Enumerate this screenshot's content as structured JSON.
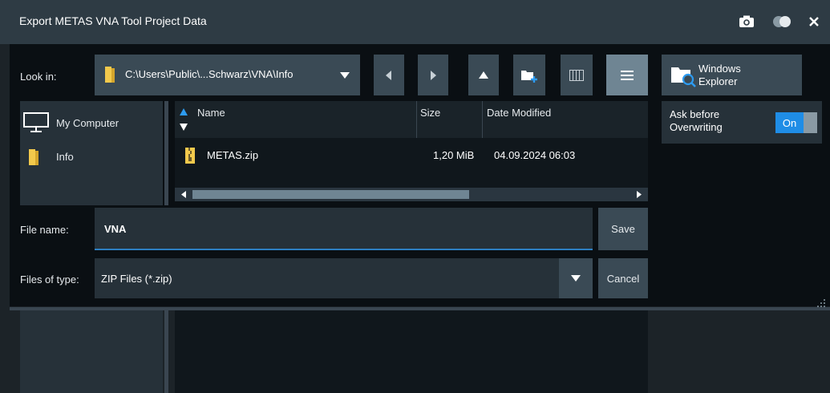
{
  "title": "Export METAS VNA Tool Project Data",
  "look_in": {
    "label": "Look in:",
    "path": "C:\\Users\\Public\\...Schwarz\\VNA\\Info"
  },
  "windows_explorer": {
    "line1": "Windows",
    "line2": "Explorer"
  },
  "ask_overwrite": {
    "line1": "Ask before",
    "line2": "Overwriting",
    "state": "On"
  },
  "places": [
    {
      "label": "My Computer",
      "icon": "computer-icon"
    },
    {
      "label": "Info",
      "icon": "folder-icon"
    }
  ],
  "columns": {
    "name": "Name",
    "size": "Size",
    "date": "Date Modified"
  },
  "files": [
    {
      "name": "METAS.zip",
      "size": "1,20 MiB",
      "date": "04.09.2024 06:03",
      "icon": "zip-file-icon"
    }
  ],
  "file_name": {
    "label": "File name:",
    "value": "VNA"
  },
  "file_type": {
    "label": "Files of type:",
    "value": "ZIP Files (*.zip)"
  },
  "buttons": {
    "save": "Save",
    "cancel": "Cancel"
  },
  "colors": {
    "accent": "#2d7fc2",
    "title_bar": "#2e3b44",
    "panel": "#263139",
    "folder": "#f2c94c",
    "toggle_on": "#1f8de6"
  }
}
